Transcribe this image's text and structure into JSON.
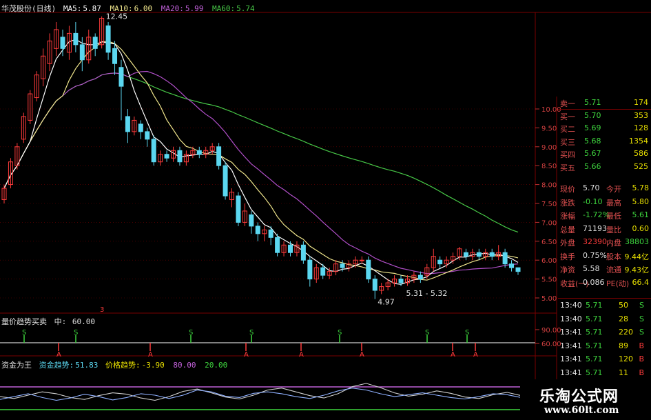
{
  "colors": {
    "up": "#ff3b3b",
    "down": "#5bd7f0",
    "ma5": "#ffffff",
    "ma10": "#f0e68c",
    "ma20": "#b04fc8",
    "ma60": "#47c847",
    "grid": "#7a0000",
    "yellow": "#e8e000",
    "green": "#3ed63e"
  },
  "header": {
    "stock": "华茂股份(日线)",
    "ma5_label": "MA5:",
    "ma5_value": "5.87",
    "ma10_label": "MA10:",
    "ma10_value": "6.00",
    "ma20_label": "MA20:",
    "ma20_value": "5.99",
    "ma60_label": "MA60:",
    "ma60_value": "5.74"
  },
  "price_axis": [
    "10.00",
    "9.50",
    "9.00",
    "8.50",
    "8.00",
    "7.50",
    "7.00",
    "6.50",
    "6.00",
    "5.50",
    "5.00"
  ],
  "annotations": {
    "high": "12.45",
    "low": "4.97",
    "range": "5.31 - 5.32",
    "marker": "3"
  },
  "indicator1": {
    "title": "量价趋势买卖",
    "mid_label": "中:",
    "mid_value": "60.00",
    "axis": [
      "90.00",
      "60.00"
    ],
    "s_label": "S",
    "a_label": "A"
  },
  "indicator2": {
    "title": "资金为王",
    "f1_label": "资金趋势:",
    "f1_value": "51.83",
    "f2_label": "价格趋势:",
    "f2_value": "-3.90",
    "f3": "80.00",
    "f4": "20.00"
  },
  "quotes": [
    {
      "label": "卖一",
      "price": "5.71",
      "vol": "174"
    },
    {
      "label": "买一",
      "price": "5.70",
      "vol": "353"
    },
    {
      "label": "买二",
      "price": "5.69",
      "vol": "128"
    },
    {
      "label": "买三",
      "price": "5.68",
      "vol": "1354"
    },
    {
      "label": "买四",
      "price": "5.67",
      "vol": "586"
    },
    {
      "label": "买五",
      "price": "5.66",
      "vol": "525"
    }
  ],
  "stats": [
    {
      "l1": "现价",
      "v1": "5.70",
      "l2": "今开",
      "v2": "5.78"
    },
    {
      "l1": "涨跌",
      "v1": "-0.10",
      "l2": "最高",
      "v2": "5.80"
    },
    {
      "l1": "涨幅",
      "v1": "-1.72%",
      "l2": "最低",
      "v2": "5.61"
    },
    {
      "l1": "总量",
      "v1": "71193",
      "l2": "量比",
      "v2": "0.60"
    },
    {
      "l1": "外盘",
      "v1": "32390",
      "l2": "内盘",
      "v2": "38803"
    },
    {
      "l1": "换手",
      "v1": "0.75%",
      "l2": "股本",
      "v2": "9.44亿"
    },
    {
      "l1": "净资",
      "v1": "5.58",
      "l2": "流通",
      "v2": "9.43亿"
    },
    {
      "l1": "收益(一)",
      "v1": "0.086",
      "l2": "PE(动)",
      "v2": "66.4"
    }
  ],
  "ticks": [
    {
      "time": "13:40",
      "price": "5.71",
      "vol": "50",
      "side": "S"
    },
    {
      "time": "13:40",
      "price": "5.71",
      "vol": "28",
      "side": "S"
    },
    {
      "time": "13:41",
      "price": "5.71",
      "vol": "220",
      "side": "S"
    },
    {
      "time": "13:41",
      "price": "5.71",
      "vol": "89",
      "side": "B"
    },
    {
      "time": "13:41",
      "price": "5.71",
      "vol": "120",
      "side": "B"
    },
    {
      "time": "13:41",
      "price": "5.71",
      "vol": "11",
      "side": "B"
    }
  ],
  "brand": {
    "title": "乐淘公式网",
    "url": "www.60lt.com"
  }
}
